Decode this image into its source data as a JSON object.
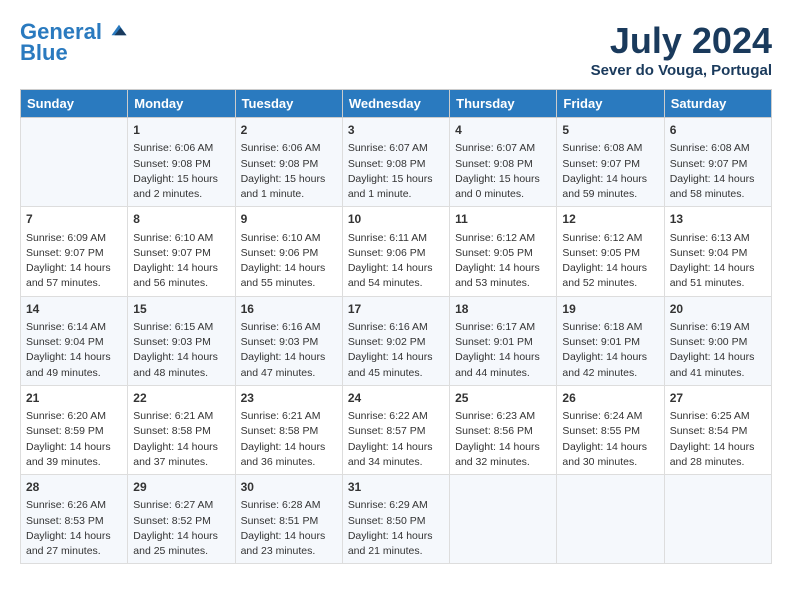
{
  "header": {
    "logo_line1": "General",
    "logo_line2": "Blue",
    "month_title": "July 2024",
    "location": "Sever do Vouga, Portugal"
  },
  "weekdays": [
    "Sunday",
    "Monday",
    "Tuesday",
    "Wednesday",
    "Thursday",
    "Friday",
    "Saturday"
  ],
  "weeks": [
    [
      {
        "day": "",
        "info": ""
      },
      {
        "day": "1",
        "info": "Sunrise: 6:06 AM\nSunset: 9:08 PM\nDaylight: 15 hours\nand 2 minutes."
      },
      {
        "day": "2",
        "info": "Sunrise: 6:06 AM\nSunset: 9:08 PM\nDaylight: 15 hours\nand 1 minute."
      },
      {
        "day": "3",
        "info": "Sunrise: 6:07 AM\nSunset: 9:08 PM\nDaylight: 15 hours\nand 1 minute."
      },
      {
        "day": "4",
        "info": "Sunrise: 6:07 AM\nSunset: 9:08 PM\nDaylight: 15 hours\nand 0 minutes."
      },
      {
        "day": "5",
        "info": "Sunrise: 6:08 AM\nSunset: 9:07 PM\nDaylight: 14 hours\nand 59 minutes."
      },
      {
        "day": "6",
        "info": "Sunrise: 6:08 AM\nSunset: 9:07 PM\nDaylight: 14 hours\nand 58 minutes."
      }
    ],
    [
      {
        "day": "7",
        "info": "Sunrise: 6:09 AM\nSunset: 9:07 PM\nDaylight: 14 hours\nand 57 minutes."
      },
      {
        "day": "8",
        "info": "Sunrise: 6:10 AM\nSunset: 9:07 PM\nDaylight: 14 hours\nand 56 minutes."
      },
      {
        "day": "9",
        "info": "Sunrise: 6:10 AM\nSunset: 9:06 PM\nDaylight: 14 hours\nand 55 minutes."
      },
      {
        "day": "10",
        "info": "Sunrise: 6:11 AM\nSunset: 9:06 PM\nDaylight: 14 hours\nand 54 minutes."
      },
      {
        "day": "11",
        "info": "Sunrise: 6:12 AM\nSunset: 9:05 PM\nDaylight: 14 hours\nand 53 minutes."
      },
      {
        "day": "12",
        "info": "Sunrise: 6:12 AM\nSunset: 9:05 PM\nDaylight: 14 hours\nand 52 minutes."
      },
      {
        "day": "13",
        "info": "Sunrise: 6:13 AM\nSunset: 9:04 PM\nDaylight: 14 hours\nand 51 minutes."
      }
    ],
    [
      {
        "day": "14",
        "info": "Sunrise: 6:14 AM\nSunset: 9:04 PM\nDaylight: 14 hours\nand 49 minutes."
      },
      {
        "day": "15",
        "info": "Sunrise: 6:15 AM\nSunset: 9:03 PM\nDaylight: 14 hours\nand 48 minutes."
      },
      {
        "day": "16",
        "info": "Sunrise: 6:16 AM\nSunset: 9:03 PM\nDaylight: 14 hours\nand 47 minutes."
      },
      {
        "day": "17",
        "info": "Sunrise: 6:16 AM\nSunset: 9:02 PM\nDaylight: 14 hours\nand 45 minutes."
      },
      {
        "day": "18",
        "info": "Sunrise: 6:17 AM\nSunset: 9:01 PM\nDaylight: 14 hours\nand 44 minutes."
      },
      {
        "day": "19",
        "info": "Sunrise: 6:18 AM\nSunset: 9:01 PM\nDaylight: 14 hours\nand 42 minutes."
      },
      {
        "day": "20",
        "info": "Sunrise: 6:19 AM\nSunset: 9:00 PM\nDaylight: 14 hours\nand 41 minutes."
      }
    ],
    [
      {
        "day": "21",
        "info": "Sunrise: 6:20 AM\nSunset: 8:59 PM\nDaylight: 14 hours\nand 39 minutes."
      },
      {
        "day": "22",
        "info": "Sunrise: 6:21 AM\nSunset: 8:58 PM\nDaylight: 14 hours\nand 37 minutes."
      },
      {
        "day": "23",
        "info": "Sunrise: 6:21 AM\nSunset: 8:58 PM\nDaylight: 14 hours\nand 36 minutes."
      },
      {
        "day": "24",
        "info": "Sunrise: 6:22 AM\nSunset: 8:57 PM\nDaylight: 14 hours\nand 34 minutes."
      },
      {
        "day": "25",
        "info": "Sunrise: 6:23 AM\nSunset: 8:56 PM\nDaylight: 14 hours\nand 32 minutes."
      },
      {
        "day": "26",
        "info": "Sunrise: 6:24 AM\nSunset: 8:55 PM\nDaylight: 14 hours\nand 30 minutes."
      },
      {
        "day": "27",
        "info": "Sunrise: 6:25 AM\nSunset: 8:54 PM\nDaylight: 14 hours\nand 28 minutes."
      }
    ],
    [
      {
        "day": "28",
        "info": "Sunrise: 6:26 AM\nSunset: 8:53 PM\nDaylight: 14 hours\nand 27 minutes."
      },
      {
        "day": "29",
        "info": "Sunrise: 6:27 AM\nSunset: 8:52 PM\nDaylight: 14 hours\nand 25 minutes."
      },
      {
        "day": "30",
        "info": "Sunrise: 6:28 AM\nSunset: 8:51 PM\nDaylight: 14 hours\nand 23 minutes."
      },
      {
        "day": "31",
        "info": "Sunrise: 6:29 AM\nSunset: 8:50 PM\nDaylight: 14 hours\nand 21 minutes."
      },
      {
        "day": "",
        "info": ""
      },
      {
        "day": "",
        "info": ""
      },
      {
        "day": "",
        "info": ""
      }
    ]
  ]
}
